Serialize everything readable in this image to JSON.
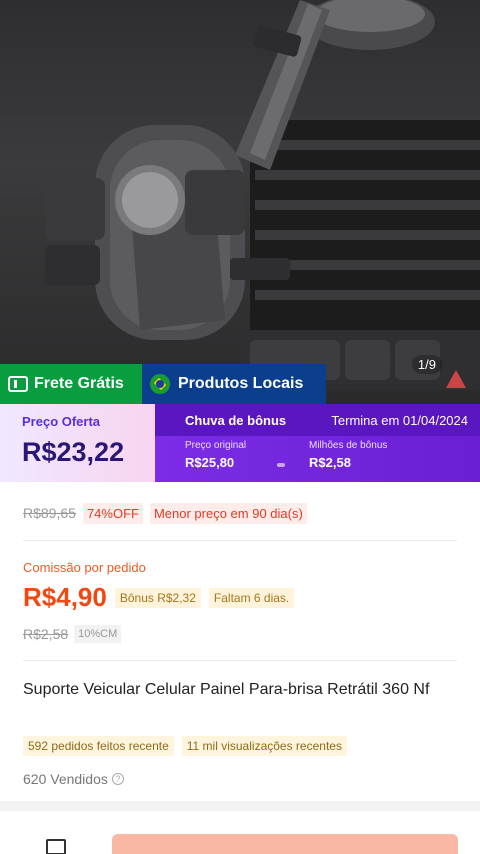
{
  "image": {
    "counter": "1/9"
  },
  "badges": {
    "free_shipping": "Frete Grátis",
    "local_products": "Produtos Locais"
  },
  "price_banner": {
    "offer_label": "Preço Oferta",
    "offer_price": "R$23,22",
    "bonus_rain": "Chuva de bônus",
    "ends_on": "Termina em 01/04/2024",
    "original_label": "Preço original",
    "original_value": "R$25,80",
    "bonus_label": "Milhões de bônus",
    "bonus_value": "R$2,58"
  },
  "details": {
    "old_price": "R$89,65",
    "discount": "74%OFF",
    "lowest_price": "Menor preço em 90 dia(s)",
    "commission_label": "Comissão por pedido",
    "commission_value": "R$4,90",
    "bonus_tag": "Bônus R$2,32",
    "days_left": "Faltam 6 dias.",
    "old_commission": "R$2,58",
    "commission_rate": "10%CM",
    "title": "Suporte Veicular Celular Painel Para-brisa Retrátil 360 Nf",
    "orders_recent": "592 pedidos feitos recente",
    "views_recent": "11 mil visualizações recentes",
    "sold": "620 Vendidos",
    "help_icon": "?"
  },
  "colors": {
    "free_badge": "#0a9d3f",
    "local_badge": "#0b3f8e",
    "bonus_purple": "#6a1fd4",
    "accent_orange": "#f2470f"
  },
  "icons": [
    "truck-icon",
    "brazil-flag-icon",
    "help-icon",
    "shop-icon"
  ]
}
